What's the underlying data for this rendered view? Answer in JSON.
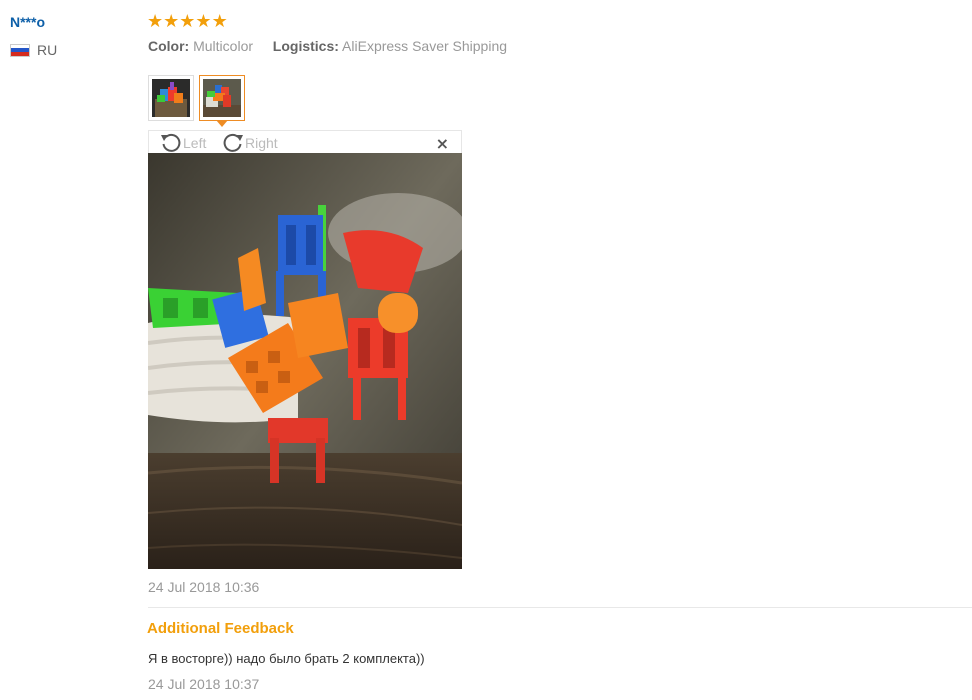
{
  "user": {
    "name": "N***o",
    "country": "RU"
  },
  "rating": {
    "stars": 5,
    "max": 5
  },
  "meta": {
    "color_label": "Color:",
    "color_value": "Multicolor",
    "logistics_label": "Logistics:",
    "logistics_value": "AliExpress Saver Shipping"
  },
  "viewer": {
    "rotate_left_label": "Left",
    "rotate_right_label": "Right",
    "close_symbol": "×"
  },
  "review": {
    "date": "24 Jul 2018 10:36",
    "additional_title": "Additional Feedback",
    "additional_text": "Я в восторге)) надо было брать 2 комплекта))",
    "additional_date": "24 Jul 2018 10:37"
  },
  "colors": {
    "accent": "#f29f0b",
    "username": "#0d5fa8",
    "thumb_selected_border": "#ee8c24"
  }
}
